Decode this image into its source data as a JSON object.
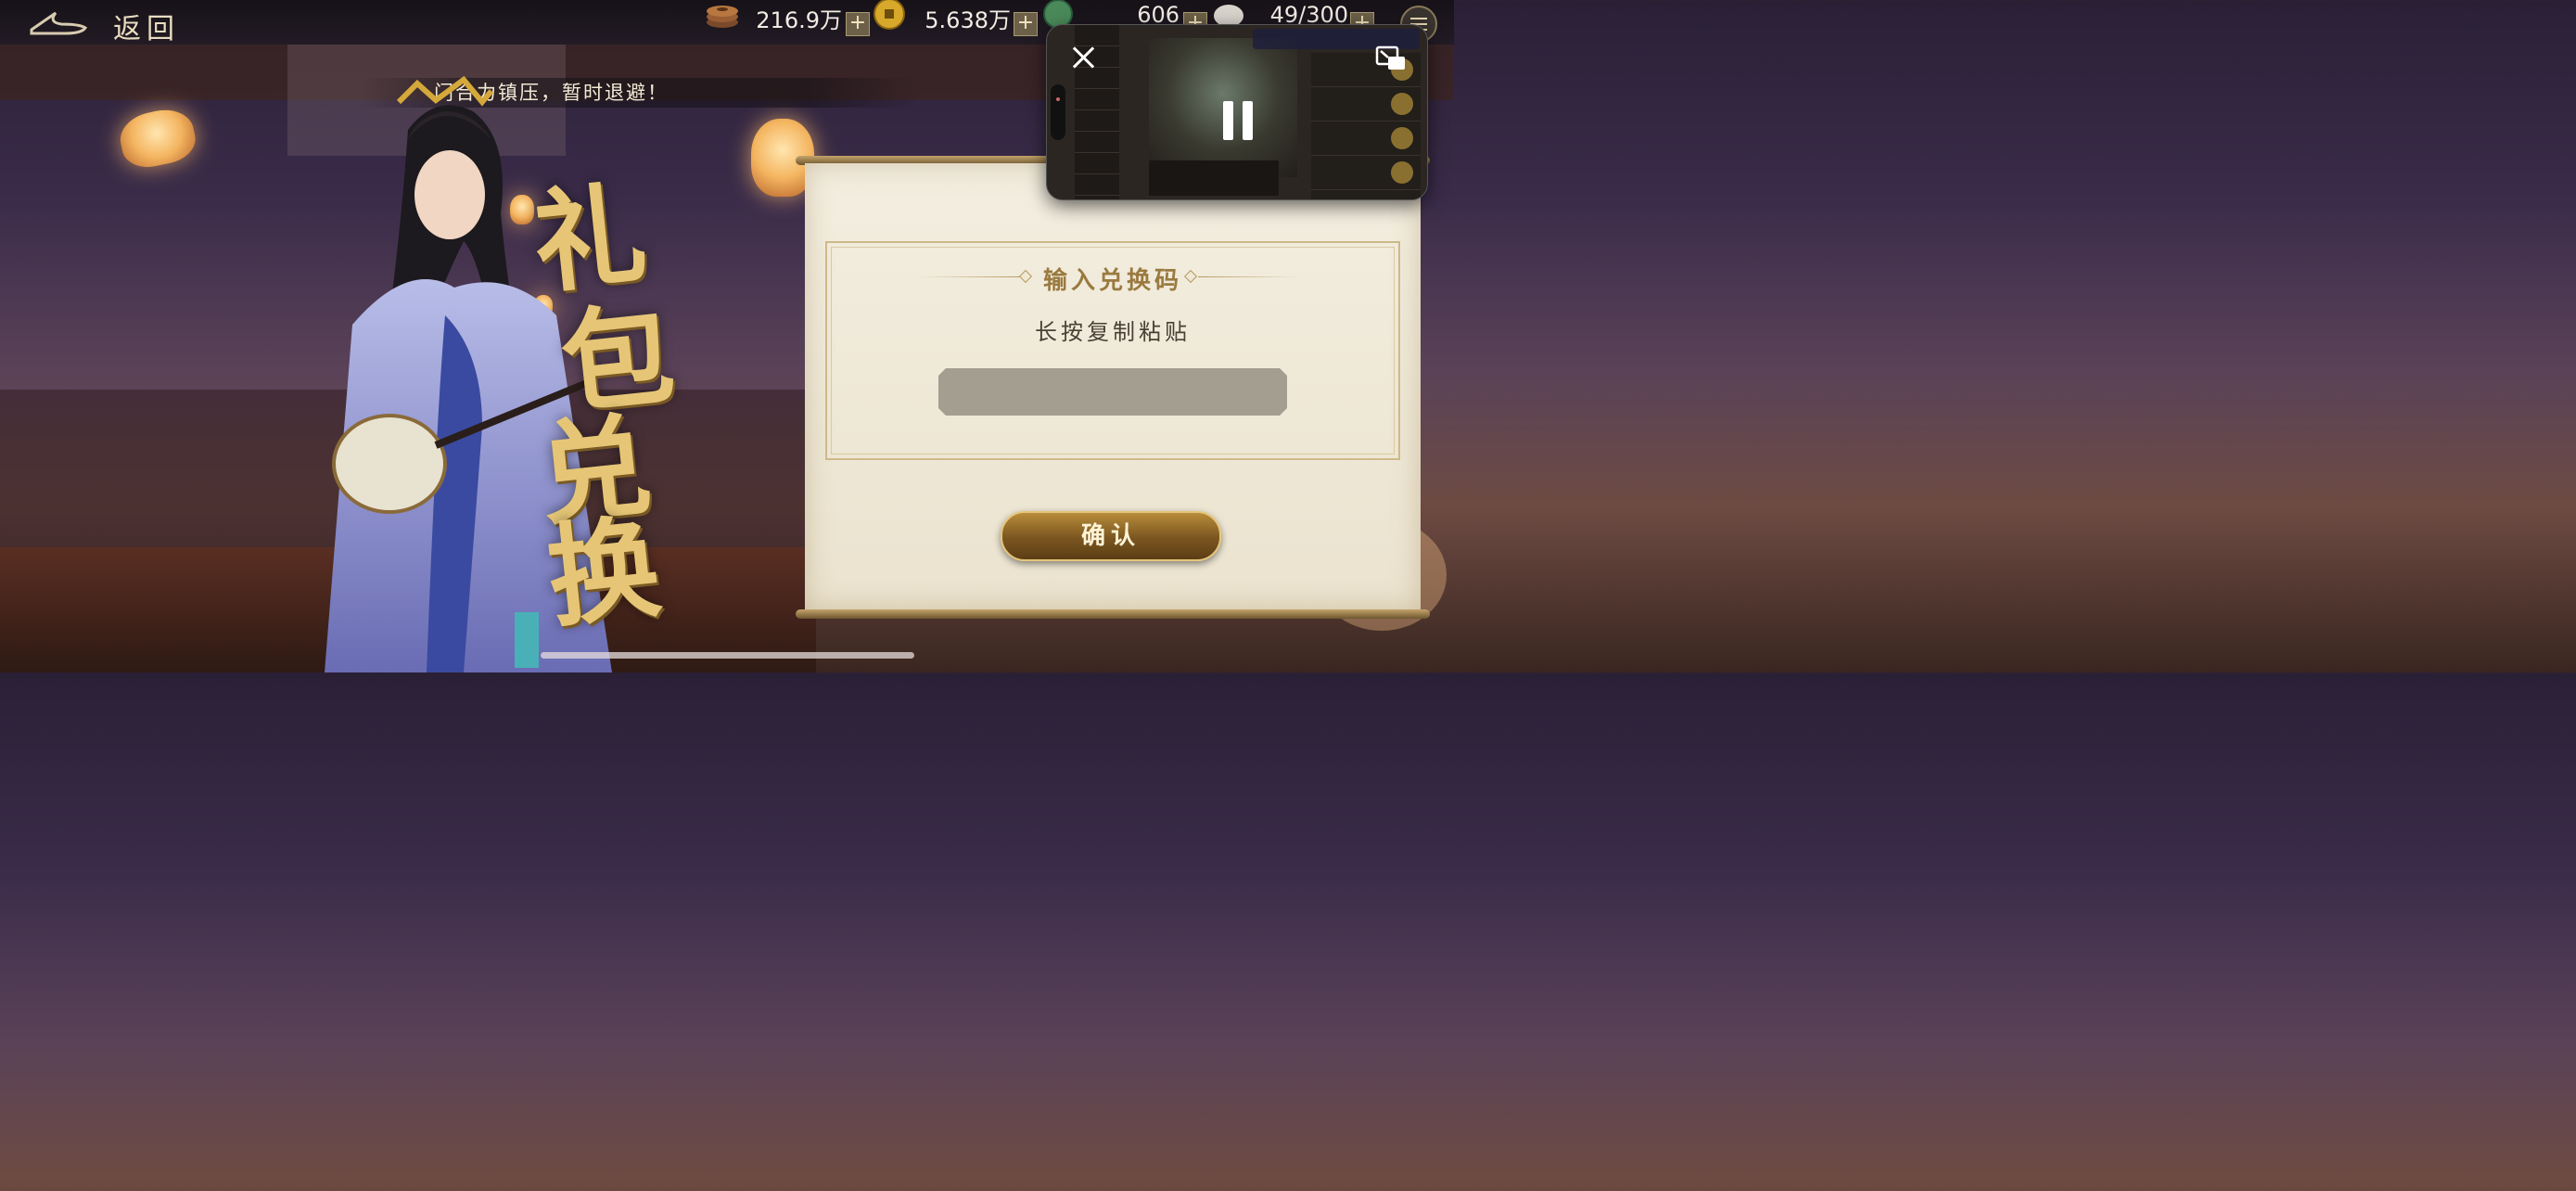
{
  "topbar": {
    "back_label": "返回",
    "resources": [
      {
        "icon": "copper-coins-icon",
        "value": "216.9万"
      },
      {
        "icon": "gold-coin-icon",
        "value": "5.638万"
      },
      {
        "icon": "jade-icon",
        "value": "606"
      },
      {
        "icon": "ration-icon",
        "value": "49/300"
      }
    ],
    "plus_label": "+"
  },
  "marquee": {
    "text": "门合力镇压，暂时退避！"
  },
  "title_calligraphy": [
    "礼",
    "包",
    "兑",
    "换"
  ],
  "panel": {
    "heading": "输入兑换码",
    "hint": "长按复制粘贴",
    "code_value": "",
    "confirm_label": "确认"
  },
  "pip": {
    "close_icon": "close-icon",
    "pause_icon": "pause-icon",
    "expand_icon": "exit-pip-icon"
  },
  "colors": {
    "accent_gold": "#e6c676",
    "panel_bg": "#f3eee0",
    "heading": "#9a7a40",
    "input_bg": "#a39e8f"
  }
}
